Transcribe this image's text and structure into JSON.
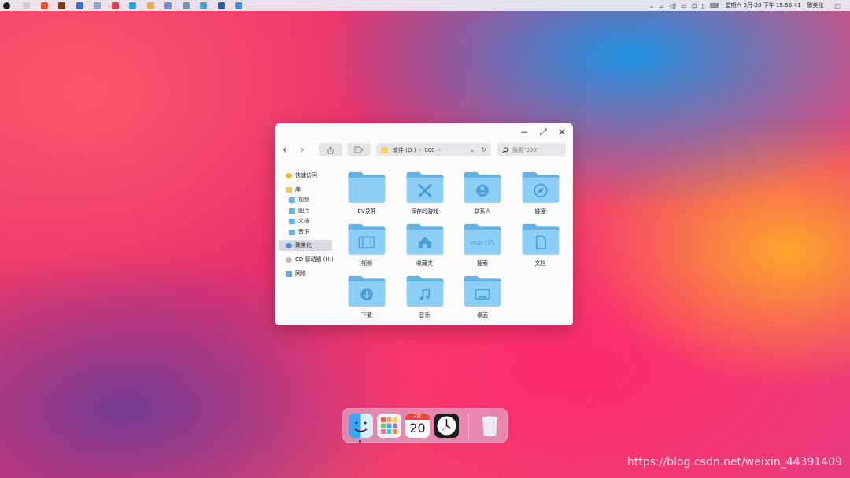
{
  "taskbar": {
    "apps": [
      {
        "name": "windows-start-icon",
        "color": "#1e1e1e"
      },
      {
        "name": "recycle-app-icon",
        "color": "#c9cdd6"
      },
      {
        "name": "office-app-icon",
        "color": "#e0542e"
      },
      {
        "name": "reader-app-icon",
        "color": "#7a3a12"
      },
      {
        "name": "security-app-icon",
        "color": "#2f6fd8"
      },
      {
        "name": "monitor-app-icon",
        "color": "#8fa6c9"
      },
      {
        "name": "music-app-icon",
        "color": "#e23c4f"
      },
      {
        "name": "editor-app-icon",
        "color": "#2aa3d8"
      },
      {
        "name": "folder-app-icon",
        "color": "#e5b43a"
      },
      {
        "name": "notes-app-icon",
        "color": "#6c8fd2"
      },
      {
        "name": "tools-app-icon",
        "color": "#7a93b0"
      },
      {
        "name": "browser-app-icon",
        "color": "#4da0c8"
      },
      {
        "name": "save-app-icon",
        "color": "#2d5aa8"
      },
      {
        "name": "cloud-app-icon",
        "color": "#3f8fe0"
      }
    ],
    "clock_text": "星期六 2月-20 下午 15:56:41",
    "username": "致美化"
  },
  "window": {
    "controls": {
      "minimize": "−",
      "maximize": "⤢",
      "close": "✕"
    },
    "nav": {
      "back": "‹",
      "forward": "›"
    },
    "path": {
      "drive": "软件 (D:)",
      "folder": "000"
    },
    "search_placeholder": "搜索\"000\""
  },
  "sidebar": {
    "quick_access": "快速访问",
    "library": "库",
    "library_items": [
      "视频",
      "图片",
      "文档",
      "音乐"
    ],
    "user": "致美化",
    "cd_drive": "CD 驱动器 (H:)",
    "network": "网络"
  },
  "folders": [
    {
      "label": "EV录屏",
      "glyph": "none"
    },
    {
      "label": "保存的游戏",
      "glyph": "tools"
    },
    {
      "label": "联系人",
      "glyph": "person"
    },
    {
      "label": "链接",
      "glyph": "compass"
    },
    {
      "label": "视频",
      "glyph": "film"
    },
    {
      "label": "收藏夹",
      "glyph": "home"
    },
    {
      "label": "搜索",
      "glyph": "macOS"
    },
    {
      "label": "文档",
      "glyph": "doc"
    },
    {
      "label": "下载",
      "glyph": "download"
    },
    {
      "label": "音乐",
      "glyph": "music"
    },
    {
      "label": "桌面",
      "glyph": "desktop"
    }
  ],
  "dock": {
    "calendar_month": "2月",
    "calendar_day": "20",
    "apps": [
      "finder-icon",
      "launchpad-icon",
      "calendar-icon",
      "clock-icon",
      "trash-icon"
    ]
  },
  "watermark": "https://blog.csdn.net/weixin_44391409",
  "colors": {
    "folder_dark": "#5fb3e6",
    "folder_light": "#8ccef5",
    "folder_glyph": "#4a9fd6"
  }
}
